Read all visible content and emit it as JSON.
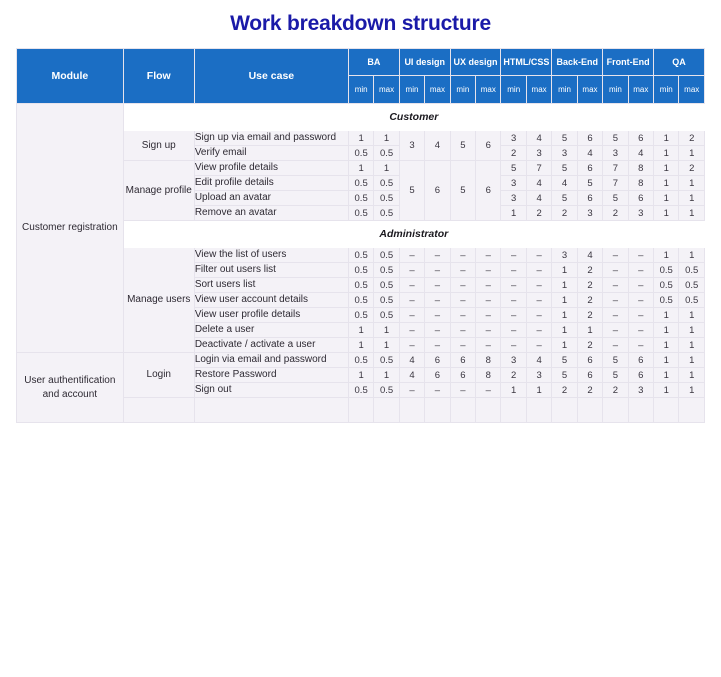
{
  "page": {
    "title": "Work breakdown structure",
    "title_color": "#1a1aa8",
    "header_color": "#1b6ec4",
    "row_tint": "#f4f2f7",
    "border_color": "#e6e3ec"
  },
  "header": {
    "module": "Module",
    "flow": "Flow",
    "usecase": "Use case",
    "groups": [
      {
        "label": "BA",
        "min": "min",
        "max": "max"
      },
      {
        "label": "UI design",
        "min": "min",
        "max": "max"
      },
      {
        "label": "UX design",
        "min": "min",
        "max": "max"
      },
      {
        "label": "HTML/CSS",
        "min": "min",
        "max": "max"
      },
      {
        "label": "Back-End",
        "min": "min",
        "max": "max"
      },
      {
        "label": "Front-End",
        "min": "min",
        "max": "max"
      },
      {
        "label": "QA",
        "min": "min",
        "max": "max"
      }
    ]
  },
  "modules": [
    {
      "name": "Customer registration"
    },
    {
      "name": "User authentification and account"
    }
  ],
  "sections": [
    {
      "label": "Customer"
    },
    {
      "label": "Administrator"
    }
  ],
  "flows": [
    {
      "name": "Sign up"
    },
    {
      "name": "Manage profile"
    },
    {
      "name": "Manage users"
    },
    {
      "name": "Login"
    }
  ],
  "rows": [
    {
      "usecase": "Sign up via email and password",
      "ba_min": "1",
      "ba_max": "1",
      "ui_min": "3",
      "ui_max": "4",
      "ux_min": "5",
      "ux_max": "6",
      "html_min": "3",
      "html_max": "4",
      "be_min": "5",
      "be_max": "6",
      "fe_min": "5",
      "fe_max": "6",
      "qa_min": "1",
      "qa_max": "2"
    },
    {
      "usecase": "Verify email",
      "ba_min": "0.5",
      "ba_max": "0.5",
      "html_min": "2",
      "html_max": "3",
      "be_min": "3",
      "be_max": "4",
      "fe_min": "3",
      "fe_max": "4",
      "qa_min": "1",
      "qa_max": "1"
    },
    {
      "usecase": "View profile details",
      "ba_min": "1",
      "ba_max": "1",
      "ui_min": "5",
      "ui_max": "6",
      "ux_min": "5",
      "ux_max": "6",
      "html_min": "5",
      "html_max": "7",
      "be_min": "5",
      "be_max": "6",
      "fe_min": "7",
      "fe_max": "8",
      "qa_min": "1",
      "qa_max": "2"
    },
    {
      "usecase": "Edit profile details",
      "ba_min": "0.5",
      "ba_max": "0.5",
      "html_min": "3",
      "html_max": "4",
      "be_min": "4",
      "be_max": "5",
      "fe_min": "7",
      "fe_max": "8",
      "qa_min": "1",
      "qa_max": "1"
    },
    {
      "usecase": "Upload an avatar",
      "ba_min": "0.5",
      "ba_max": "0.5",
      "html_min": "3",
      "html_max": "4",
      "be_min": "5",
      "be_max": "6",
      "fe_min": "5",
      "fe_max": "6",
      "qa_min": "1",
      "qa_max": "1"
    },
    {
      "usecase": "Remove an avatar",
      "ba_min": "0.5",
      "ba_max": "0.5",
      "html_min": "1",
      "html_max": "2",
      "be_min": "2",
      "be_max": "3",
      "fe_min": "2",
      "fe_max": "3",
      "qa_min": "1",
      "qa_max": "1"
    },
    {
      "usecase": "View the list of users",
      "ba_min": "0.5",
      "ba_max": "0.5",
      "ui_min": "–",
      "ui_max": "–",
      "ux_min": "–",
      "ux_max": "–",
      "html_min": "–",
      "html_max": "–",
      "be_min": "3",
      "be_max": "4",
      "fe_min": "–",
      "fe_max": "–",
      "qa_min": "1",
      "qa_max": "1"
    },
    {
      "usecase": "Filter out users list",
      "ba_min": "0.5",
      "ba_max": "0.5",
      "ui_min": "–",
      "ui_max": "–",
      "ux_min": "–",
      "ux_max": "–",
      "html_min": "–",
      "html_max": "–",
      "be_min": "1",
      "be_max": "2",
      "fe_min": "–",
      "fe_max": "–",
      "qa_min": "0.5",
      "qa_max": "0.5"
    },
    {
      "usecase": "Sort users list",
      "ba_min": "0.5",
      "ba_max": "0.5",
      "ui_min": "–",
      "ui_max": "–",
      "ux_min": "–",
      "ux_max": "–",
      "html_min": "–",
      "html_max": "–",
      "be_min": "1",
      "be_max": "2",
      "fe_min": "–",
      "fe_max": "–",
      "qa_min": "0.5",
      "qa_max": "0.5"
    },
    {
      "usecase": "View user account details",
      "ba_min": "0.5",
      "ba_max": "0.5",
      "ui_min": "–",
      "ui_max": "–",
      "ux_min": "–",
      "ux_max": "–",
      "html_min": "–",
      "html_max": "–",
      "be_min": "1",
      "be_max": "2",
      "fe_min": "–",
      "fe_max": "–",
      "qa_min": "0.5",
      "qa_max": "0.5"
    },
    {
      "usecase": "View user profile details",
      "ba_min": "0.5",
      "ba_max": "0.5",
      "ui_min": "–",
      "ui_max": "–",
      "ux_min": "–",
      "ux_max": "–",
      "html_min": "–",
      "html_max": "–",
      "be_min": "1",
      "be_max": "2",
      "fe_min": "–",
      "fe_max": "–",
      "qa_min": "1",
      "qa_max": "1"
    },
    {
      "usecase": "Delete a user",
      "ba_min": "1",
      "ba_max": "1",
      "ui_min": "–",
      "ui_max": "–",
      "ux_min": "–",
      "ux_max": "–",
      "html_min": "–",
      "html_max": "–",
      "be_min": "1",
      "be_max": "1",
      "fe_min": "–",
      "fe_max": "–",
      "qa_min": "1",
      "qa_max": "1"
    },
    {
      "usecase": "Deactivate / activate a user",
      "ba_min": "1",
      "ba_max": "1",
      "ui_min": "–",
      "ui_max": "–",
      "ux_min": "–",
      "ux_max": "–",
      "html_min": "–",
      "html_max": "–",
      "be_min": "1",
      "be_max": "2",
      "fe_min": "–",
      "fe_max": "–",
      "qa_min": "1",
      "qa_max": "1"
    },
    {
      "usecase": "Login via email and password",
      "ba_min": "0.5",
      "ba_max": "0.5",
      "ui_min": "4",
      "ui_max": "6",
      "ux_min": "6",
      "ux_max": "8",
      "html_min": "3",
      "html_max": "4",
      "be_min": "5",
      "be_max": "6",
      "fe_min": "5",
      "fe_max": "6",
      "qa_min": "1",
      "qa_max": "1"
    },
    {
      "usecase": "Restore Password",
      "ba_min": "1",
      "ba_max": "1",
      "ui_min": "4",
      "ui_max": "6",
      "ux_min": "6",
      "ux_max": "8",
      "html_min": "2",
      "html_max": "3",
      "be_min": "5",
      "be_max": "6",
      "fe_min": "5",
      "fe_max": "6",
      "qa_min": "1",
      "qa_max": "1"
    },
    {
      "usecase": "Sign out",
      "ba_min": "0.5",
      "ba_max": "0.5",
      "ui_min": "–",
      "ui_max": "–",
      "ux_min": "–",
      "ux_max": "–",
      "html_min": "1",
      "html_max": "1",
      "be_min": "2",
      "be_max": "2",
      "fe_min": "2",
      "fe_max": "3",
      "qa_min": "1",
      "qa_max": "1"
    }
  ]
}
